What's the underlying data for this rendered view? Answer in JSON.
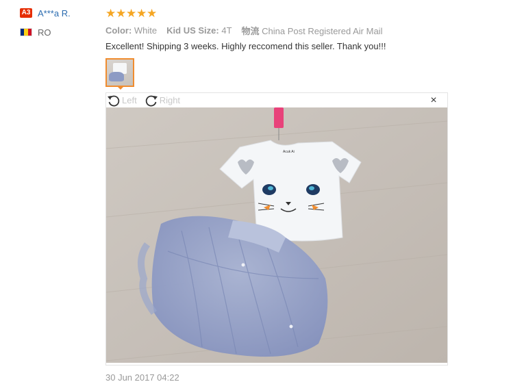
{
  "reviewer": {
    "level_badge": "A3",
    "name": "A***a R.",
    "country_code": "RO",
    "flag_colors": [
      "#002b7f",
      "#fcd116",
      "#ce1126"
    ]
  },
  "review": {
    "rating": 5,
    "star_color": "#f5a623",
    "attributes": [
      {
        "key": "Color:",
        "value": "White"
      },
      {
        "key": "Kid US Size:",
        "value": "4T"
      },
      {
        "key": "物流",
        "value": "China Post Registered Air Mail"
      }
    ],
    "text": "Excellent! Shipping 3 weeks. Highly reccomend this seller. Thank you!!!",
    "date": "30 Jun 2017 04:22"
  },
  "viewer": {
    "rotate_left_label": "Left",
    "rotate_right_label": "Right",
    "close_symbol": "×",
    "photo_label": "Acuk Ai"
  }
}
